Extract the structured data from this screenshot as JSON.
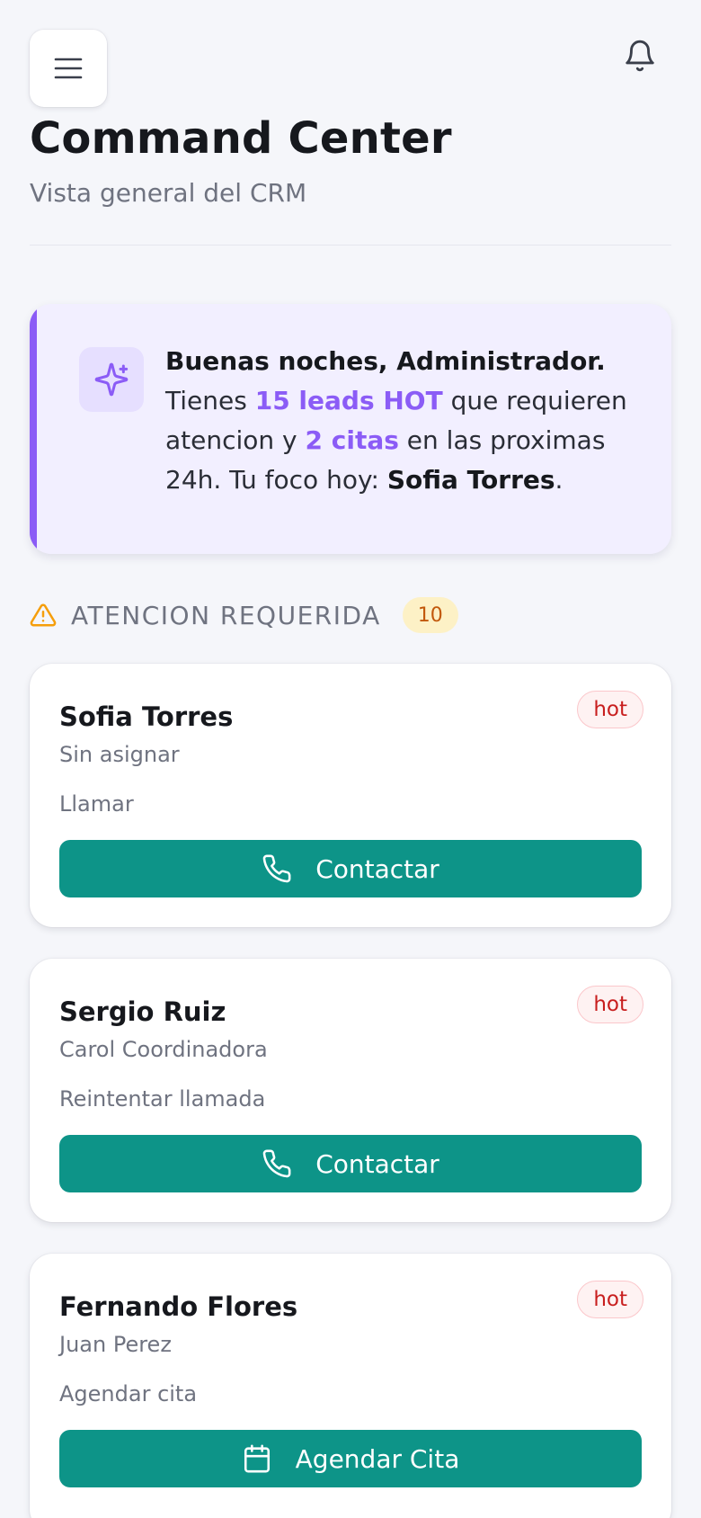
{
  "header": {
    "title": "Command Center",
    "subtitle": "Vista general del CRM",
    "menu_icon": "menu-icon",
    "notification_icon": "bell-icon"
  },
  "briefing": {
    "icon": "sparkles-icon",
    "greeting": "Buenas noches, Administrador.",
    "text_1": "Tienes ",
    "hot_leads": "15 leads HOT",
    "text_2": " que requieren atencion y ",
    "appointments": "2 citas",
    "text_3": " en las proximas 24h. Tu foco hoy: ",
    "focus_name": "Sofia Torres",
    "text_4": ".",
    "accent_color": "#8b5cf6"
  },
  "attention": {
    "icon": "warning-icon",
    "title": "ATENCION REQUERIDA",
    "count": "10",
    "items": [
      {
        "name": "Sofia Torres",
        "badge": "hot",
        "owner": "Sin asignar",
        "action": "Llamar",
        "button_label": "Contactar",
        "button_icon": "phone-icon"
      },
      {
        "name": "Sergio Ruiz",
        "badge": "hot",
        "owner": "Carol Coordinadora",
        "action": "Reintentar llamada",
        "button_label": "Contactar",
        "button_icon": "phone-icon"
      },
      {
        "name": "Fernando Flores",
        "badge": "hot",
        "owner": "Juan Perez",
        "action": "Agendar cita",
        "button_label": "Agendar Cita",
        "button_icon": "calendar-icon"
      }
    ]
  },
  "colors": {
    "primary_button": "#0d9488",
    "hot_badge_text": "#c81e1e",
    "count_badge_bg": "#fdf1c6"
  }
}
